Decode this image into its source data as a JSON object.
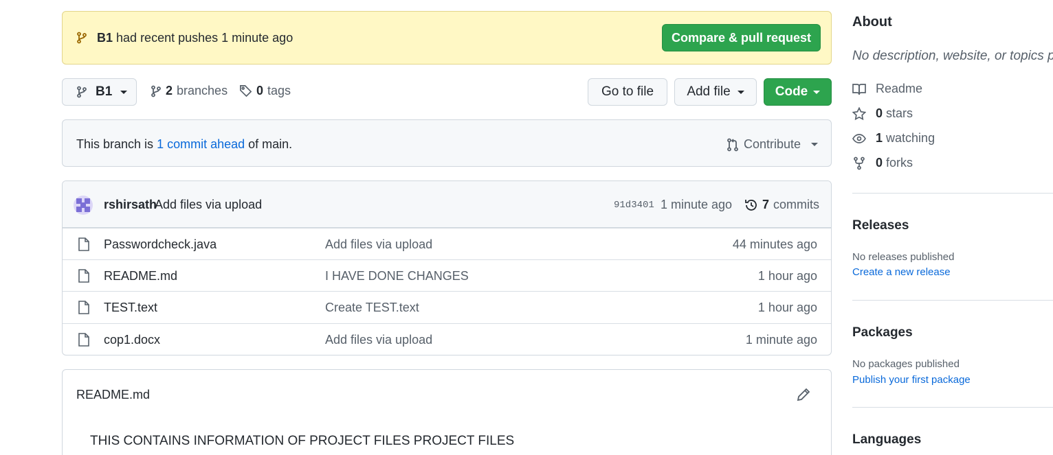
{
  "push_banner": {
    "branch": "B1",
    "message": "had recent pushes 1 minute ago",
    "button": "Compare & pull request"
  },
  "toolbar": {
    "branch": "B1",
    "branches_count": "2",
    "branches_label": "branches",
    "tags_count": "0",
    "tags_label": "tags",
    "go_to_file": "Go to file",
    "add_file": "Add file",
    "code": "Code"
  },
  "ahead": {
    "prefix": "This branch is",
    "link": "1 commit ahead",
    "suffix": "of main.",
    "contribute": "Contribute"
  },
  "latest_commit": {
    "author": "rshirsath",
    "message": "Add files via upload",
    "sha": "91d3401",
    "time": "1 minute ago",
    "commits_count": "7",
    "commits_label": "commits"
  },
  "files": [
    {
      "name": "Passwordcheck.java",
      "message": "Add files via upload",
      "age": "44 minutes ago"
    },
    {
      "name": "README.md",
      "message": "I HAVE DONE CHANGES",
      "age": "1 hour ago"
    },
    {
      "name": "TEST.text",
      "message": "Create TEST.text",
      "age": "1 hour ago"
    },
    {
      "name": "cop1.docx",
      "message": "Add files via upload",
      "age": "1 minute ago"
    }
  ],
  "readme": {
    "title": "README.md",
    "body": "THIS CONTAINS INFORMATION OF PROJECT FILES PROJECT FILES"
  },
  "sidebar": {
    "about_title": "About",
    "about_desc": "No description, website, or topics provided.",
    "readme": "Readme",
    "stars_count": "0",
    "stars_label": "stars",
    "watching_count": "1",
    "watching_label": "watching",
    "forks_count": "0",
    "forks_label": "forks",
    "releases_title": "Releases",
    "releases_empty": "No releases published",
    "releases_link": "Create a new release",
    "packages_title": "Packages",
    "packages_empty": "No packages published",
    "packages_link": "Publish your first package",
    "languages_title": "Languages"
  },
  "colors": {
    "accent_green": "#2da44e",
    "link_blue": "#0969da",
    "banner_yellow": "#fff8c5"
  }
}
